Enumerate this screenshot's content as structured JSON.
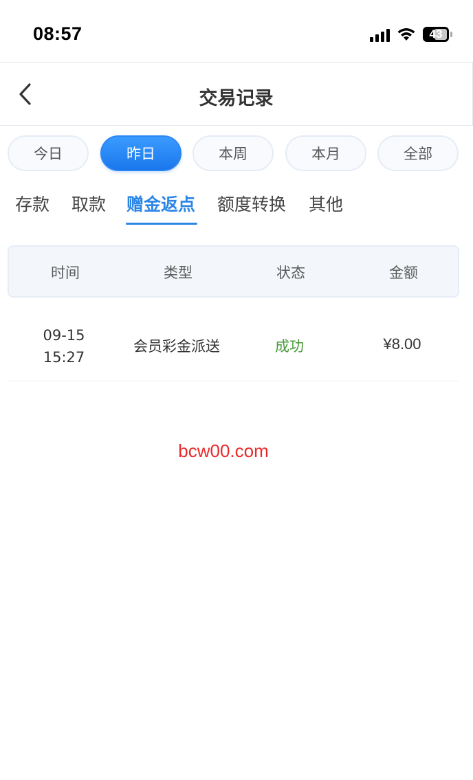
{
  "status_bar": {
    "time": "08:57",
    "battery": "43",
    "icons": [
      "signal-icon",
      "wifi-icon",
      "battery-icon"
    ]
  },
  "header": {
    "back_icon": "chevron-left-icon",
    "title": "交易记录"
  },
  "date_filter": {
    "options": [
      "今日",
      "昨日",
      "本周",
      "本月",
      "全部"
    ],
    "selected": "昨日"
  },
  "category_tabs": {
    "items": [
      "存款",
      "取款",
      "赠金返点",
      "额度转换",
      "其他"
    ],
    "selected": "赠金返点"
  },
  "table": {
    "columns": [
      "时间",
      "类型",
      "状态",
      "金额"
    ],
    "rows": [
      {
        "date": "09-15",
        "time": "15:27",
        "type": "会员彩金派送",
        "status": "成功",
        "amount": "¥8.00"
      }
    ]
  },
  "watermark": "bcw00.com",
  "colors": {
    "accent": "#2c86e6",
    "pill_active": "#1a77ec",
    "status_success": "#4a9a3a",
    "watermark": "#e8292a"
  }
}
